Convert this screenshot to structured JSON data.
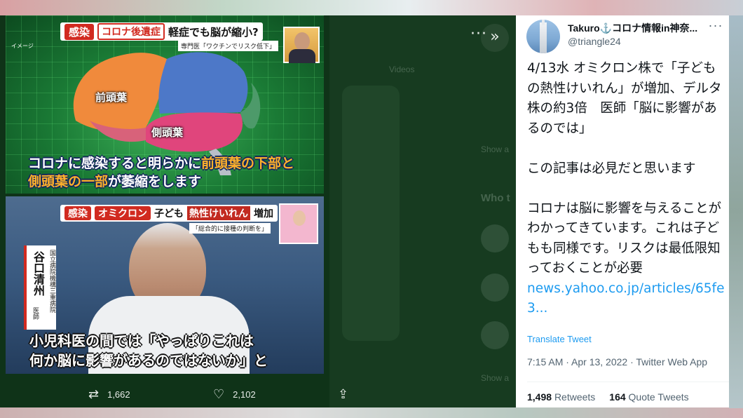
{
  "modal": {
    "close_icon": "»",
    "more_icon": "···",
    "ghost_texts": [
      "Videos",
      "Who t",
      "Show a",
      "Show a",
      "Show a"
    ]
  },
  "image1": {
    "corner_label": "イメージ",
    "tag_infection": "感染",
    "tag_after_effect": "コロナ後遺症",
    "title_rest": "軽症でも脳が縮小?",
    "subtitle": "専門医「ワクチンでリスク低下」",
    "label_frontal": "前頭葉",
    "label_temporal": "側頭葉",
    "caption_line1_a": "コロナに感染すると明らかに",
    "caption_line1_b": "前頭葉の下部と",
    "caption_line2_a": "側頭葉の一部",
    "caption_line2_b": "が萎縮をします"
  },
  "image2": {
    "tag_infection": "感染",
    "tag_omicron": "オミクロン",
    "title_mid": "子ども",
    "title_hl": "熱性けいれん",
    "title_end": "増加",
    "subtitle": "「総合的に接種の判断を」",
    "nameplate_org": "国立病院機構三重病院",
    "nameplate_name": "谷口清州",
    "nameplate_title": "医師",
    "caption_line1": "小児科医の間では「やっぱりこれは",
    "caption_line2": "何か脳に影響があるのではないか」と"
  },
  "actions": {
    "retweet_count": "1,662",
    "like_count": "2,102"
  },
  "tweet": {
    "display_name": "Takuro⚓コロナ情報in神奈...",
    "handle": "@triangle24",
    "more_icon": "···",
    "text": "4/13水 オミクロン株で「子どもの熱性けいれん」が増加、デルタ株の約3倍　医師「脳に影響があるのでは」\n\nこの記事は必見だと思います\n\nコロナは脳に影響を与えることがわかってきています。これは子どもも同様です。リスクは最低限知っておくことが必要\n",
    "link": "news.yahoo.co.jp/articles/65fe3...",
    "translate_label": "Translate Tweet",
    "timestamp": "7:15 AM · Apr 13, 2022 · Twitter Web App",
    "retweets_count": "1,498",
    "retweets_label": "Retweets",
    "quote_count": "164",
    "quote_label": "Quote Tweets"
  }
}
